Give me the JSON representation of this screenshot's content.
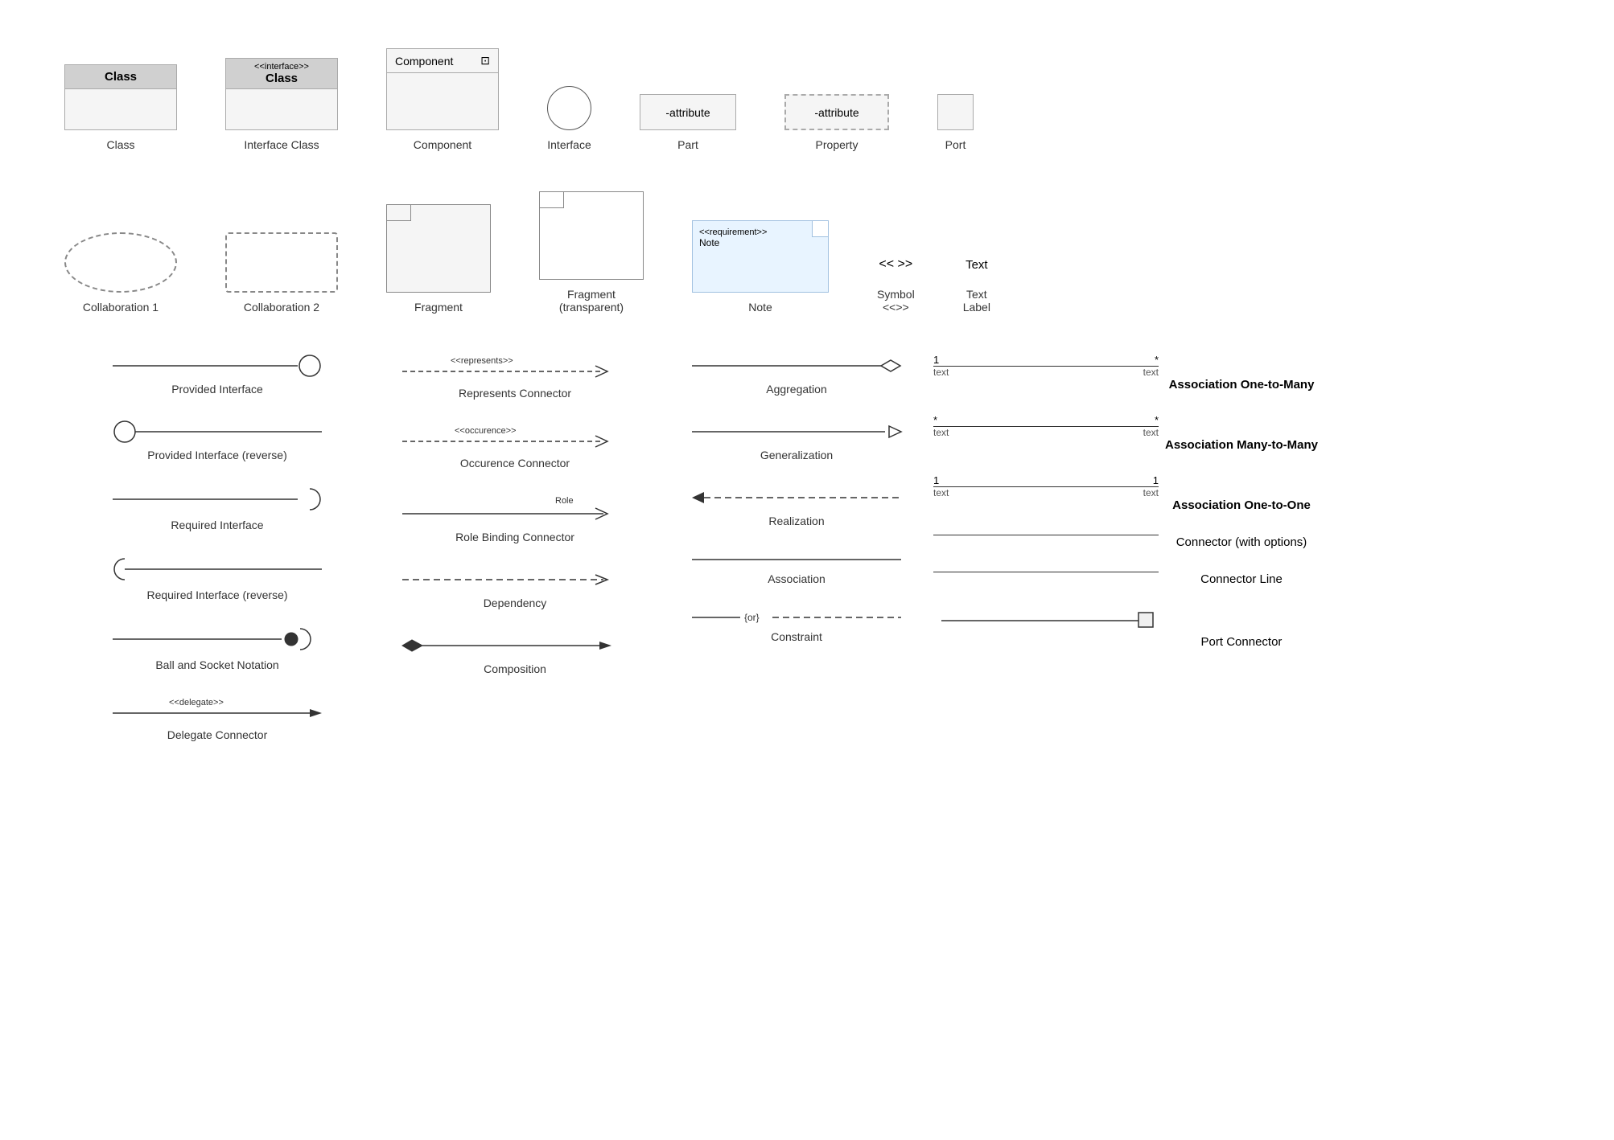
{
  "row1": {
    "items": [
      {
        "id": "class",
        "label": "Class"
      },
      {
        "id": "interface-class",
        "label": "Interface Class",
        "stereotype": "<<interface>>",
        "name": "Class"
      },
      {
        "id": "component",
        "label": "Component",
        "header": "Component"
      },
      {
        "id": "interface",
        "label": "Interface"
      },
      {
        "id": "part",
        "label": "Part",
        "text": "-attribute"
      },
      {
        "id": "property",
        "label": "Property",
        "text": "-attribute"
      },
      {
        "id": "port",
        "label": "Port"
      }
    ]
  },
  "row2": {
    "items": [
      {
        "id": "collab1",
        "label": "Collaboration 1"
      },
      {
        "id": "collab2",
        "label": "Collaboration 2"
      },
      {
        "id": "fragment",
        "label": "Fragment"
      },
      {
        "id": "fragment-transparent",
        "label": "Fragment\n(transparent)"
      },
      {
        "id": "note",
        "label": "Note",
        "stereotype": "<<requirement>>",
        "name": "Note"
      },
      {
        "id": "symbol",
        "label": "Symbol\n<<>>",
        "chevron": "<< >>"
      },
      {
        "id": "textlabel",
        "label": "Text\nLabel",
        "lines": [
          "Text",
          "Text",
          "Label"
        ]
      }
    ]
  },
  "row3": {
    "left": [
      {
        "id": "provided-iface",
        "label": "Provided Interface"
      },
      {
        "id": "provided-iface-rev",
        "label": "Provided Interface (reverse)"
      },
      {
        "id": "required-iface",
        "label": "Required Interface"
      },
      {
        "id": "required-iface-rev",
        "label": "Required Interface (reverse)"
      },
      {
        "id": "ball-socket",
        "label": "Ball and Socket Notation"
      },
      {
        "id": "delegate",
        "label": "Delegate Connector",
        "stereotype": "<<delegate>>"
      }
    ],
    "mid1": [
      {
        "id": "represents",
        "label": "Represents Connector",
        "stereotype": "<<represents>>"
      },
      {
        "id": "occurence",
        "label": "Occurence Connector",
        "stereotype": "<<occurence>>"
      },
      {
        "id": "role-binding",
        "label": "Role Binding Connector",
        "role": "Role"
      },
      {
        "id": "dependency",
        "label": "Dependency"
      },
      {
        "id": "composition",
        "label": "Composition"
      }
    ],
    "mid2": [
      {
        "id": "aggregation",
        "label": "Aggregation"
      },
      {
        "id": "generalization",
        "label": "Generalization"
      },
      {
        "id": "realization",
        "label": "Realization"
      },
      {
        "id": "association",
        "label": "Association"
      },
      {
        "id": "constraint",
        "label": "Constraint",
        "text": "{or}"
      }
    ],
    "right": [
      {
        "id": "assoc-one-many",
        "label": "Association One-to-Many",
        "left_mult": "1",
        "right_mult": "*",
        "left_role": "text",
        "right_role": "text"
      },
      {
        "id": "assoc-many-many",
        "label": "Association Many-to-Many",
        "left_mult": "*",
        "right_mult": "*",
        "left_role": "text",
        "right_role": "text"
      },
      {
        "id": "assoc-one-one",
        "label": "Association One-to-One",
        "left_mult": "1",
        "right_mult": "1",
        "left_role": "text",
        "right_role": "text"
      },
      {
        "id": "connector-options",
        "label": "Connector (with options)"
      },
      {
        "id": "connector-line",
        "label": "Connector Line"
      },
      {
        "id": "port-connector",
        "label": "Port Connector"
      }
    ]
  }
}
